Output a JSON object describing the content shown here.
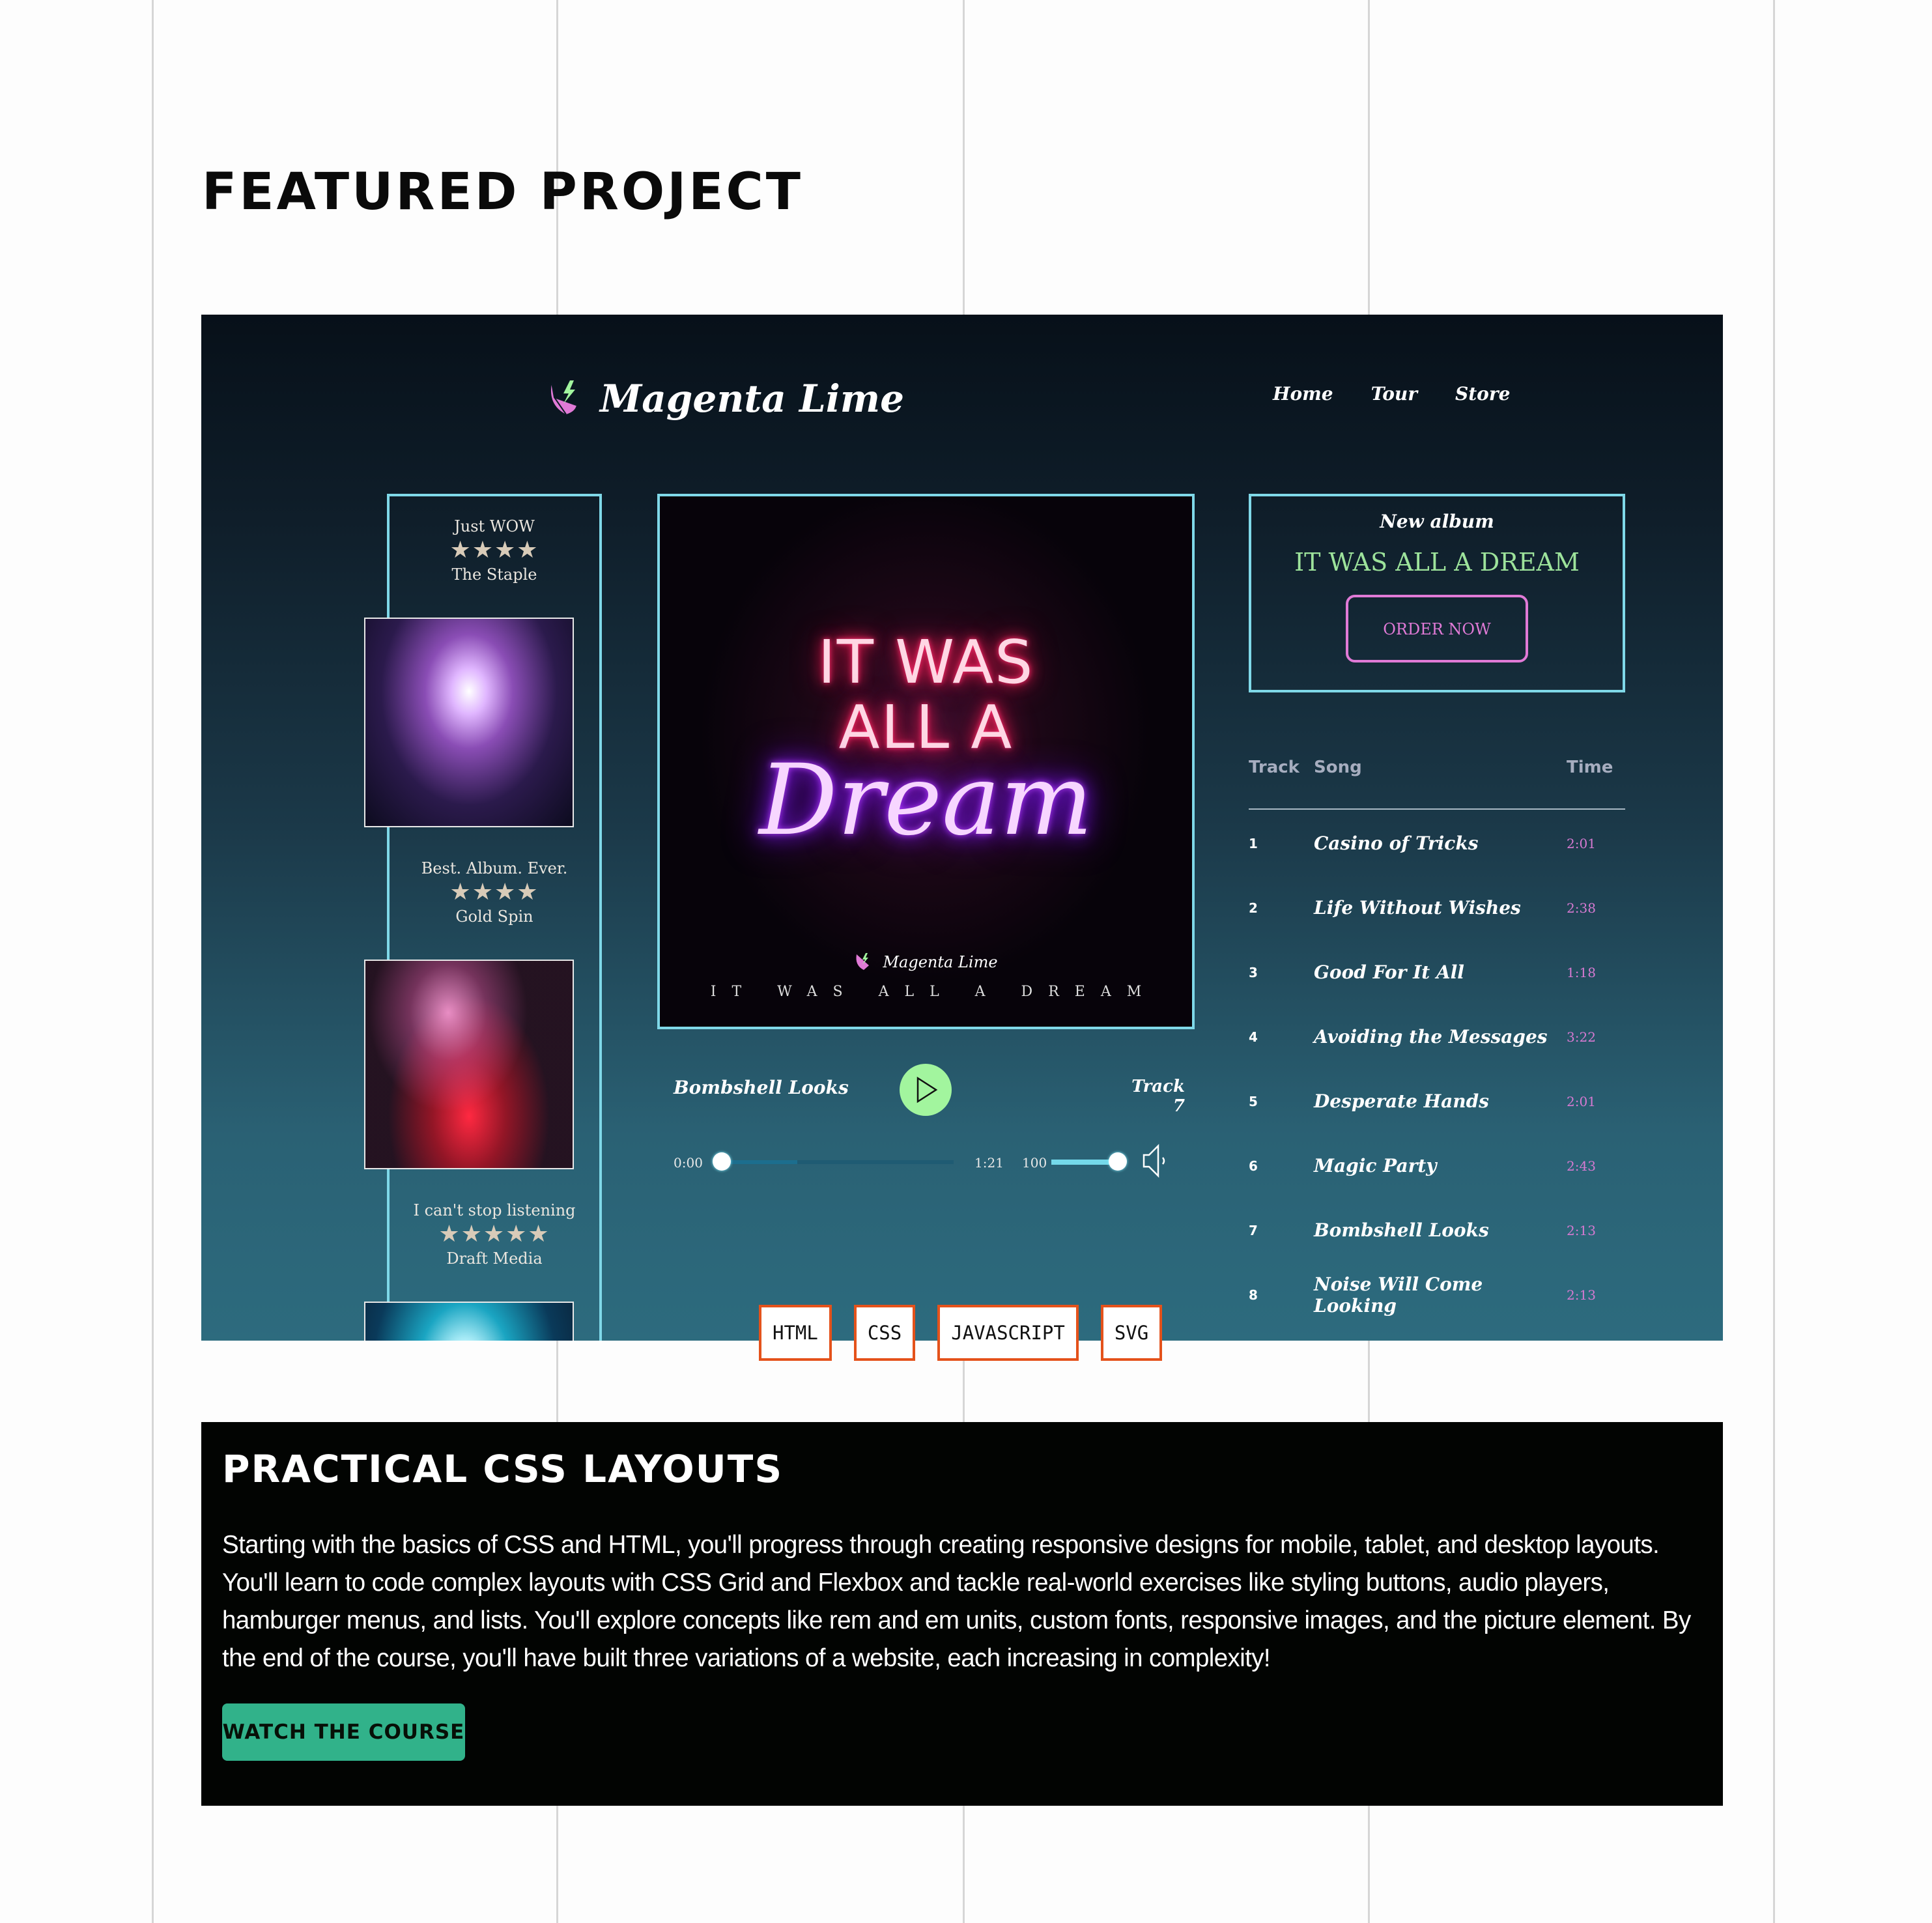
{
  "section": {
    "heading": "FEATURED PROJECT"
  },
  "project": {
    "brand": "Magenta Lime",
    "nav": [
      "Home",
      "Tour",
      "Store"
    ],
    "reviews": [
      {
        "quote": "Just WOW",
        "rating": 4,
        "stars": "★★★★",
        "source": "The Staple"
      },
      {
        "quote": "Best. Album. Ever.",
        "rating": 4,
        "stars": "★★★★",
        "source": "Gold Spin"
      },
      {
        "quote": "I can't stop listening",
        "rating": 5,
        "stars": "★★★★★",
        "source": "Draft Media"
      }
    ],
    "album_art": {
      "neon_line1": "IT WAS",
      "neon_line2": "ALL A",
      "neon_line3": "Dream",
      "brand": "Magenta Lime",
      "subtitle": "IT WAS ALL A DREAM"
    },
    "player": {
      "song": "Bombshell Looks",
      "track": "Track 7",
      "current_time": "0:00",
      "duration": "1:21",
      "progress_percent": 0,
      "volume": "100",
      "volume_percent": 100,
      "play_icon": "play-icon",
      "volume_icon": "speaker-icon"
    },
    "promo": {
      "label": "New album",
      "title": "IT WAS ALL A DREAM",
      "button": "ORDER NOW"
    },
    "tracklist": {
      "headers": [
        "Track",
        "Song",
        "Time"
      ],
      "rows": [
        {
          "n": "1",
          "song": "Casino of Tricks",
          "time": "2:01"
        },
        {
          "n": "2",
          "song": "Life Without Wishes",
          "time": "2:38"
        },
        {
          "n": "3",
          "song": "Good For It All",
          "time": "1:18"
        },
        {
          "n": "4",
          "song": "Avoiding the Messages",
          "time": "3:22"
        },
        {
          "n": "5",
          "song": "Desperate Hands",
          "time": "2:01"
        },
        {
          "n": "6",
          "song": "Magic Party",
          "time": "2:43"
        },
        {
          "n": "7",
          "song": "Bombshell Looks",
          "time": "2:13"
        },
        {
          "n": "8",
          "song": "Noise Will Come Looking",
          "time": "2:13"
        }
      ]
    },
    "tags": [
      "HTML",
      "CSS",
      "JAVASCRIPT",
      "SVG"
    ]
  },
  "course": {
    "title": "PRACTICAL CSS LAYOUTS",
    "description": "Starting with the basics of CSS and HTML, you'll progress through creating responsive designs for mobile, tablet, and desktop layouts. You'll learn to code complex layouts with CSS Grid and Flexbox and tackle real-world exercises like styling buttons, audio players, hamburger menus, and lists. You'll explore concepts like rem and em units, custom fonts, responsive images, and the picture element. By the end of the course, you'll have built three variations of a website, each increasing in complexity!",
    "button": "WATCH THE COURSE"
  },
  "colors": {
    "accent_cyan": "#7fd8e8",
    "accent_magenta": "#e07ad6",
    "accent_lime": "#a2f59e",
    "tag_border": "#e4521b",
    "course_button": "#31b28a"
  }
}
